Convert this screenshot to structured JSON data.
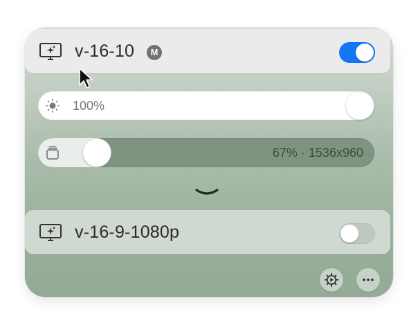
{
  "displays": [
    {
      "name": "v-16-10",
      "badge": "M",
      "enabled": true,
      "icon": "display-sparkle-icon"
    },
    {
      "name": "v-16-9-1080p",
      "enabled": false,
      "icon": "display-sparkle-icon"
    }
  ],
  "brightness": {
    "label": "100%",
    "level": 1.0,
    "icon": "sun-icon"
  },
  "resolution": {
    "label": "67% · 1536x960",
    "level": 0.1,
    "icon": "stacked-windows-icon"
  },
  "expand": {
    "icon": "chevron-down-icon"
  },
  "footer": {
    "buttons": [
      {
        "icon": "gear-play-icon"
      },
      {
        "icon": "ellipsis-icon"
      }
    ]
  },
  "colors": {
    "toggle_on": "#1476f5",
    "panel_gradient_top": "#d6dbd6",
    "panel_gradient_bottom": "#93ab96"
  }
}
